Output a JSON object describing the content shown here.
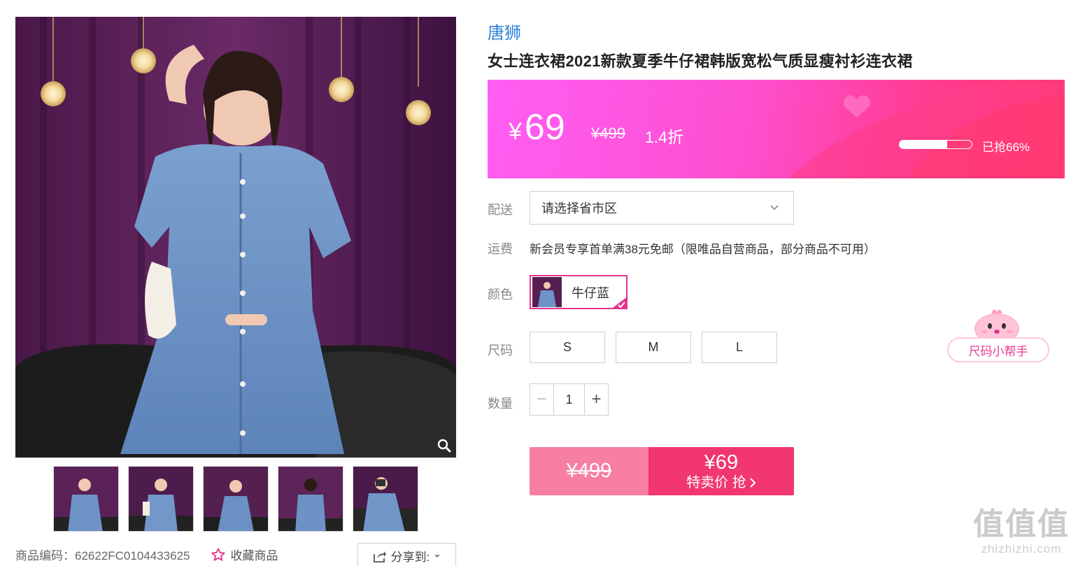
{
  "gallery": {
    "main_image_alt": "",
    "thumbnails": [
      "t1",
      "t2",
      "t3",
      "t4",
      "t5"
    ],
    "sku_label": "商品编码：62622FC0104433625",
    "favorite_label": "收藏商品",
    "share_label": "分享到:"
  },
  "product": {
    "brand": "唐狮",
    "title": "女士连衣裙2021新款夏季牛仔裙韩版宽松气质显瘦衬衫连衣裙"
  },
  "price": {
    "symbol": "¥",
    "current": "69",
    "original": "¥499",
    "discount": "1.4折",
    "sold_progress": 0.66,
    "sold_text": "已抢66%"
  },
  "delivery": {
    "label": "配送",
    "placeholder": "请选择省市区"
  },
  "shipping": {
    "label": "运费",
    "text": "新会员专享首单满38元免邮（限唯品自营商品，部分商品不可用）"
  },
  "color": {
    "label": "颜色",
    "options": [
      "牛仔蓝"
    ],
    "selected": "牛仔蓝"
  },
  "size": {
    "label": "尺码",
    "options": [
      "S",
      "M",
      "L"
    ],
    "helper": "尺码小帮手"
  },
  "quantity": {
    "label": "数量",
    "value": "1",
    "minus": "−",
    "plus": "+"
  },
  "buy": {
    "original": "¥499",
    "price": "¥69",
    "action": "特卖价 抢"
  },
  "watermark": {
    "logo": "值值值",
    "site": "zhizhizhi.com"
  },
  "colors": {
    "accent": "#e5338a",
    "buy_dark": "#f2366f",
    "buy_light": "#f77fa3",
    "brand_link": "#2a7fd4"
  }
}
